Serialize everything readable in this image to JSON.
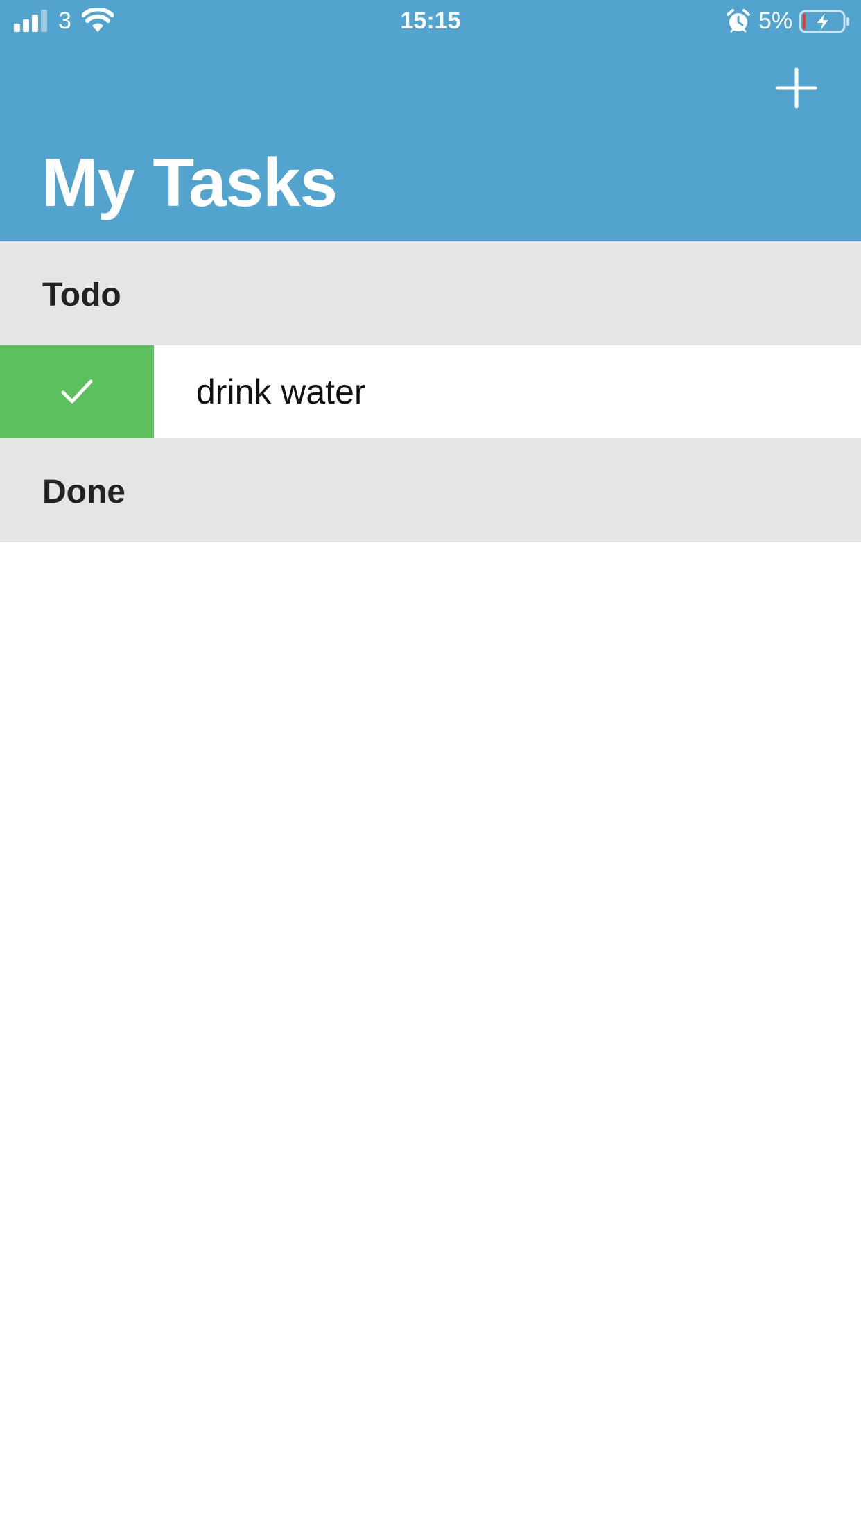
{
  "status_bar": {
    "carrier": "3",
    "time": "15:15",
    "battery_percent": "5%",
    "icons": [
      "signal-icon",
      "wifi-icon",
      "alarm-icon",
      "battery-charging-icon"
    ]
  },
  "header": {
    "title": "My Tasks",
    "add_icon": "plus-icon"
  },
  "sections": {
    "todo": {
      "label": "Todo",
      "tasks": [
        {
          "text": "drink water",
          "action_icon": "checkmark-icon"
        }
      ]
    },
    "done": {
      "label": "Done",
      "tasks": []
    }
  },
  "colors": {
    "header_bg": "#53a3cf",
    "section_bg": "#e5e5e5",
    "complete_action": "#5bbf5b",
    "battery_low": "#e0402f"
  }
}
